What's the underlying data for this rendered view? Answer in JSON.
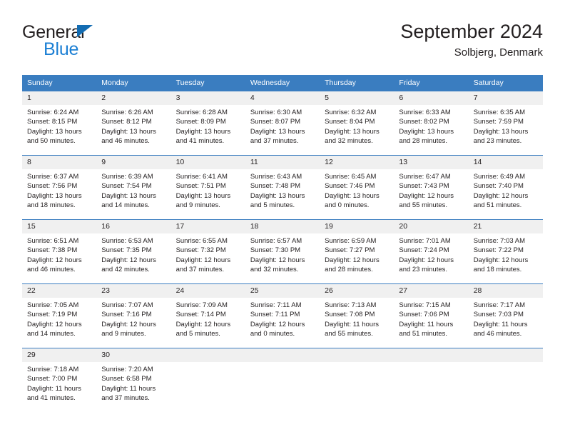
{
  "brand": {
    "line1": "General",
    "line2": "Blue",
    "triangle_color": "#136cb2"
  },
  "header": {
    "title": "September 2024",
    "subtitle": "Solbjerg, Denmark"
  },
  "colors": {
    "header_bar": "#3a7dc0",
    "daynum_band": "#f0f0f0",
    "text": "#231f20",
    "brand_blue": "#1b7fd4"
  },
  "weekday_headers": [
    "Sunday",
    "Monday",
    "Tuesday",
    "Wednesday",
    "Thursday",
    "Friday",
    "Saturday"
  ],
  "weeks": [
    [
      {
        "day": "1",
        "sunrise": "Sunrise: 6:24 AM",
        "sunset": "Sunset: 8:15 PM",
        "daylight_line1": "Daylight: 13 hours",
        "daylight_line2": "and 50 minutes."
      },
      {
        "day": "2",
        "sunrise": "Sunrise: 6:26 AM",
        "sunset": "Sunset: 8:12 PM",
        "daylight_line1": "Daylight: 13 hours",
        "daylight_line2": "and 46 minutes."
      },
      {
        "day": "3",
        "sunrise": "Sunrise: 6:28 AM",
        "sunset": "Sunset: 8:09 PM",
        "daylight_line1": "Daylight: 13 hours",
        "daylight_line2": "and 41 minutes."
      },
      {
        "day": "4",
        "sunrise": "Sunrise: 6:30 AM",
        "sunset": "Sunset: 8:07 PM",
        "daylight_line1": "Daylight: 13 hours",
        "daylight_line2": "and 37 minutes."
      },
      {
        "day": "5",
        "sunrise": "Sunrise: 6:32 AM",
        "sunset": "Sunset: 8:04 PM",
        "daylight_line1": "Daylight: 13 hours",
        "daylight_line2": "and 32 minutes."
      },
      {
        "day": "6",
        "sunrise": "Sunrise: 6:33 AM",
        "sunset": "Sunset: 8:02 PM",
        "daylight_line1": "Daylight: 13 hours",
        "daylight_line2": "and 28 minutes."
      },
      {
        "day": "7",
        "sunrise": "Sunrise: 6:35 AM",
        "sunset": "Sunset: 7:59 PM",
        "daylight_line1": "Daylight: 13 hours",
        "daylight_line2": "and 23 minutes."
      }
    ],
    [
      {
        "day": "8",
        "sunrise": "Sunrise: 6:37 AM",
        "sunset": "Sunset: 7:56 PM",
        "daylight_line1": "Daylight: 13 hours",
        "daylight_line2": "and 18 minutes."
      },
      {
        "day": "9",
        "sunrise": "Sunrise: 6:39 AM",
        "sunset": "Sunset: 7:54 PM",
        "daylight_line1": "Daylight: 13 hours",
        "daylight_line2": "and 14 minutes."
      },
      {
        "day": "10",
        "sunrise": "Sunrise: 6:41 AM",
        "sunset": "Sunset: 7:51 PM",
        "daylight_line1": "Daylight: 13 hours",
        "daylight_line2": "and 9 minutes."
      },
      {
        "day": "11",
        "sunrise": "Sunrise: 6:43 AM",
        "sunset": "Sunset: 7:48 PM",
        "daylight_line1": "Daylight: 13 hours",
        "daylight_line2": "and 5 minutes."
      },
      {
        "day": "12",
        "sunrise": "Sunrise: 6:45 AM",
        "sunset": "Sunset: 7:46 PM",
        "daylight_line1": "Daylight: 13 hours",
        "daylight_line2": "and 0 minutes."
      },
      {
        "day": "13",
        "sunrise": "Sunrise: 6:47 AM",
        "sunset": "Sunset: 7:43 PM",
        "daylight_line1": "Daylight: 12 hours",
        "daylight_line2": "and 55 minutes."
      },
      {
        "day": "14",
        "sunrise": "Sunrise: 6:49 AM",
        "sunset": "Sunset: 7:40 PM",
        "daylight_line1": "Daylight: 12 hours",
        "daylight_line2": "and 51 minutes."
      }
    ],
    [
      {
        "day": "15",
        "sunrise": "Sunrise: 6:51 AM",
        "sunset": "Sunset: 7:38 PM",
        "daylight_line1": "Daylight: 12 hours",
        "daylight_line2": "and 46 minutes."
      },
      {
        "day": "16",
        "sunrise": "Sunrise: 6:53 AM",
        "sunset": "Sunset: 7:35 PM",
        "daylight_line1": "Daylight: 12 hours",
        "daylight_line2": "and 42 minutes."
      },
      {
        "day": "17",
        "sunrise": "Sunrise: 6:55 AM",
        "sunset": "Sunset: 7:32 PM",
        "daylight_line1": "Daylight: 12 hours",
        "daylight_line2": "and 37 minutes."
      },
      {
        "day": "18",
        "sunrise": "Sunrise: 6:57 AM",
        "sunset": "Sunset: 7:30 PM",
        "daylight_line1": "Daylight: 12 hours",
        "daylight_line2": "and 32 minutes."
      },
      {
        "day": "19",
        "sunrise": "Sunrise: 6:59 AM",
        "sunset": "Sunset: 7:27 PM",
        "daylight_line1": "Daylight: 12 hours",
        "daylight_line2": "and 28 minutes."
      },
      {
        "day": "20",
        "sunrise": "Sunrise: 7:01 AM",
        "sunset": "Sunset: 7:24 PM",
        "daylight_line1": "Daylight: 12 hours",
        "daylight_line2": "and 23 minutes."
      },
      {
        "day": "21",
        "sunrise": "Sunrise: 7:03 AM",
        "sunset": "Sunset: 7:22 PM",
        "daylight_line1": "Daylight: 12 hours",
        "daylight_line2": "and 18 minutes."
      }
    ],
    [
      {
        "day": "22",
        "sunrise": "Sunrise: 7:05 AM",
        "sunset": "Sunset: 7:19 PM",
        "daylight_line1": "Daylight: 12 hours",
        "daylight_line2": "and 14 minutes."
      },
      {
        "day": "23",
        "sunrise": "Sunrise: 7:07 AM",
        "sunset": "Sunset: 7:16 PM",
        "daylight_line1": "Daylight: 12 hours",
        "daylight_line2": "and 9 minutes."
      },
      {
        "day": "24",
        "sunrise": "Sunrise: 7:09 AM",
        "sunset": "Sunset: 7:14 PM",
        "daylight_line1": "Daylight: 12 hours",
        "daylight_line2": "and 5 minutes."
      },
      {
        "day": "25",
        "sunrise": "Sunrise: 7:11 AM",
        "sunset": "Sunset: 7:11 PM",
        "daylight_line1": "Daylight: 12 hours",
        "daylight_line2": "and 0 minutes."
      },
      {
        "day": "26",
        "sunrise": "Sunrise: 7:13 AM",
        "sunset": "Sunset: 7:08 PM",
        "daylight_line1": "Daylight: 11 hours",
        "daylight_line2": "and 55 minutes."
      },
      {
        "day": "27",
        "sunrise": "Sunrise: 7:15 AM",
        "sunset": "Sunset: 7:06 PM",
        "daylight_line1": "Daylight: 11 hours",
        "daylight_line2": "and 51 minutes."
      },
      {
        "day": "28",
        "sunrise": "Sunrise: 7:17 AM",
        "sunset": "Sunset: 7:03 PM",
        "daylight_line1": "Daylight: 11 hours",
        "daylight_line2": "and 46 minutes."
      }
    ],
    [
      {
        "day": "29",
        "sunrise": "Sunrise: 7:18 AM",
        "sunset": "Sunset: 7:00 PM",
        "daylight_line1": "Daylight: 11 hours",
        "daylight_line2": "and 41 minutes."
      },
      {
        "day": "30",
        "sunrise": "Sunrise: 7:20 AM",
        "sunset": "Sunset: 6:58 PM",
        "daylight_line1": "Daylight: 11 hours",
        "daylight_line2": "and 37 minutes."
      },
      {
        "day": "",
        "sunrise": "",
        "sunset": "",
        "daylight_line1": "",
        "daylight_line2": ""
      },
      {
        "day": "",
        "sunrise": "",
        "sunset": "",
        "daylight_line1": "",
        "daylight_line2": ""
      },
      {
        "day": "",
        "sunrise": "",
        "sunset": "",
        "daylight_line1": "",
        "daylight_line2": ""
      },
      {
        "day": "",
        "sunrise": "",
        "sunset": "",
        "daylight_line1": "",
        "daylight_line2": ""
      },
      {
        "day": "",
        "sunrise": "",
        "sunset": "",
        "daylight_line1": "",
        "daylight_line2": ""
      }
    ]
  ]
}
